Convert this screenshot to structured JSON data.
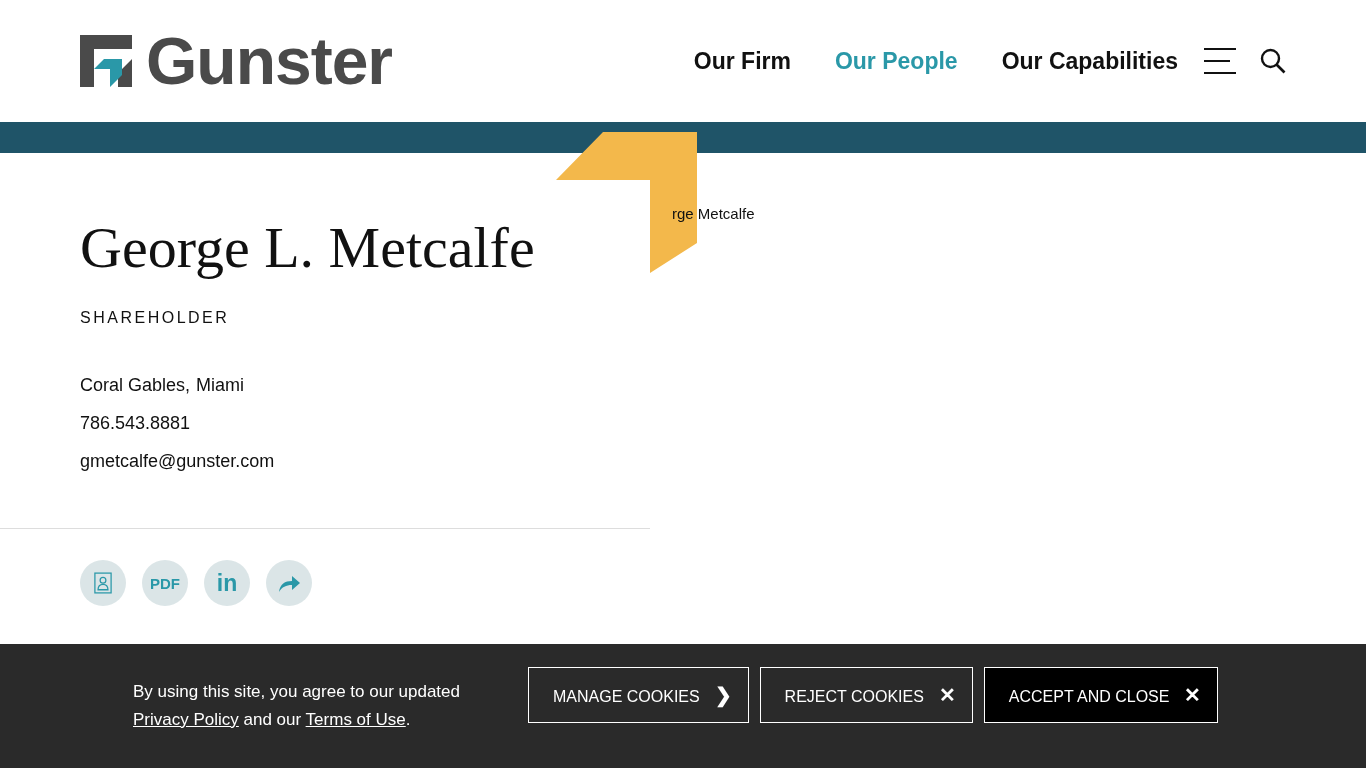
{
  "header": {
    "logo": "Gunster",
    "nav": [
      {
        "label": "Our Firm",
        "selected": false
      },
      {
        "label": "Our People",
        "selected": true
      },
      {
        "label": "Our Capabilities",
        "selected": false
      }
    ]
  },
  "breadcrumb": "rge Metcalfe",
  "profile": {
    "name": "George L. Metcalfe",
    "title": "SHAREHOLDER",
    "locations": [
      "Coral Gables,",
      "Miami"
    ],
    "phone": "786.543.8881",
    "email": "gmetcalfe@gunster.com",
    "actions": [
      {
        "kind": "vcard"
      },
      {
        "kind": "pdf",
        "label": "PDF"
      },
      {
        "kind": "linkedin",
        "label": "in"
      },
      {
        "kind": "share"
      }
    ]
  },
  "cookie_banner": {
    "text": "By using this site, you agree to our updated",
    "links": [
      "Privacy Policy",
      "Terms of Use"
    ],
    "joiner": "and our",
    "end": ".",
    "buttons": [
      {
        "label": "MANAGE COOKIES",
        "icon": "❯",
        "primary": false
      },
      {
        "label": "REJECT COOKIES",
        "icon": "✕",
        "primary": false
      },
      {
        "label": "ACCEPT AND CLOSE",
        "icon": "✕",
        "primary": true
      }
    ]
  }
}
